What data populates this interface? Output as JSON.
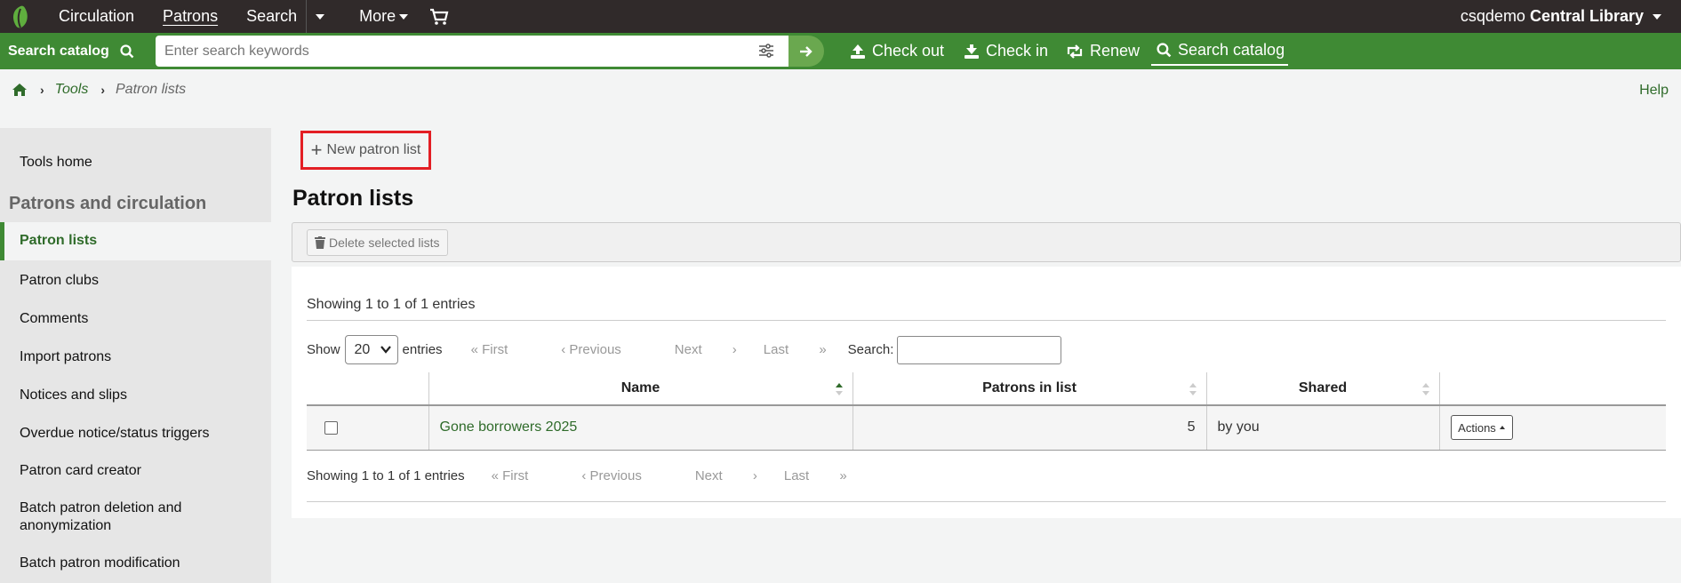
{
  "topnav": {
    "items": [
      "Circulation",
      "Patrons",
      "Search",
      "More"
    ],
    "active": "Patrons",
    "user_prefix": "csqdemo",
    "user_library": "Central Library"
  },
  "searchbar": {
    "label": "Search catalog",
    "placeholder": "Enter search keywords",
    "quick_links": [
      "Check out",
      "Check in",
      "Renew",
      "Search catalog"
    ]
  },
  "breadcrumb": {
    "items": [
      "Tools",
      "Patron lists"
    ]
  },
  "help": "Help",
  "sidebar": {
    "tools_home": "Tools home",
    "heading": "Patrons and circulation",
    "items": [
      "Patron lists",
      "Patron clubs",
      "Comments",
      "Import patrons",
      "Notices and slips",
      "Overdue notice/status triggers",
      "Patron card creator",
      "Batch patron deletion and anonymization",
      "Batch patron modification"
    ]
  },
  "main": {
    "new_button": "New patron list",
    "title": "Patron lists",
    "delete_button": "Delete selected lists",
    "info": "Showing 1 to 1 of 1 entries",
    "show_label": "Show",
    "show_value": "20",
    "entries_label": "entries",
    "pager": [
      "First",
      "Previous",
      "Next",
      "Last"
    ],
    "search_label": "Search:",
    "columns": [
      "Name",
      "Patrons in list",
      "Shared"
    ],
    "rows": [
      {
        "name": "Gone borrowers 2025",
        "patrons": "5",
        "shared": "by you",
        "actions": "Actions"
      }
    ]
  },
  "colors": {
    "nav_bg": "#302a2a",
    "brand_green": "#3f8a34",
    "link_green": "#2f6b2a",
    "highlight_red": "#e31e24"
  }
}
